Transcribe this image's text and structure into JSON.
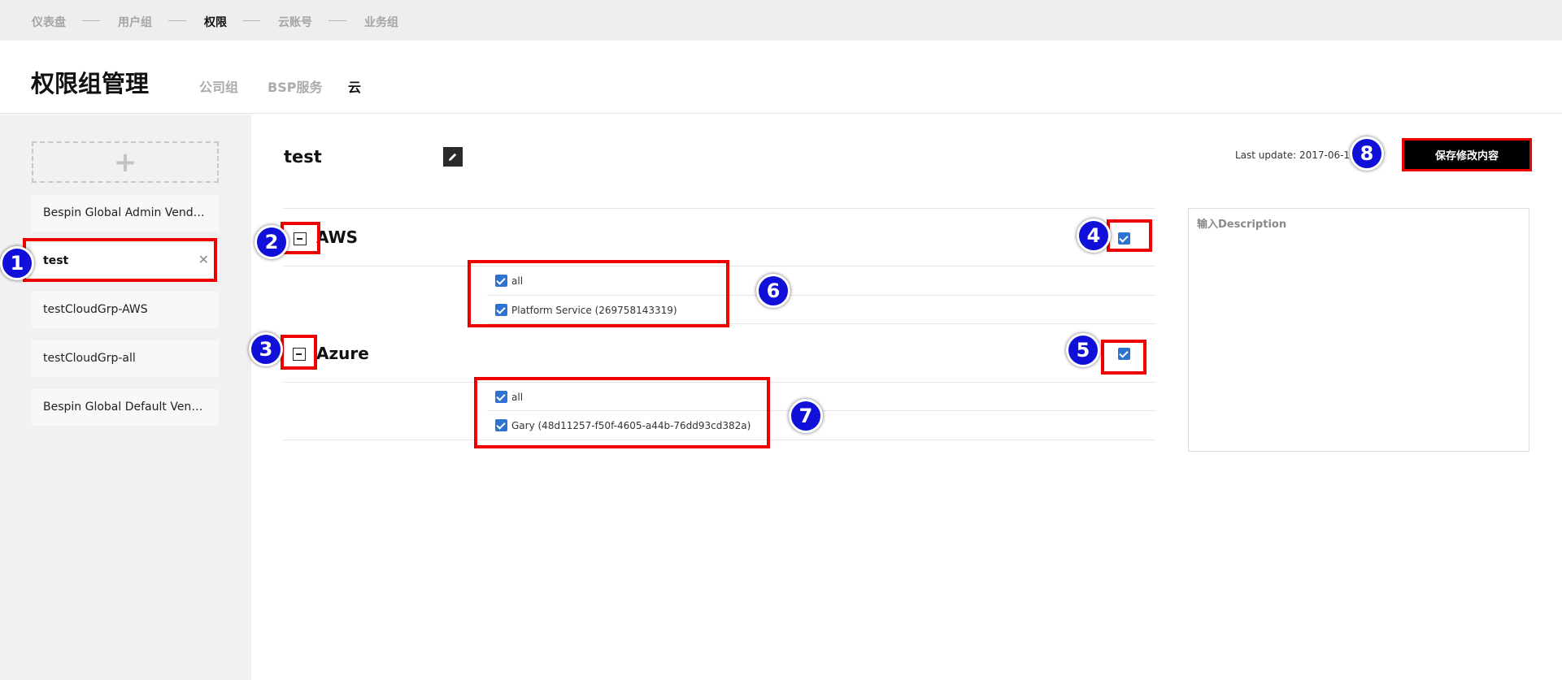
{
  "topnav": {
    "items": [
      {
        "label": "仪表盘",
        "active": false
      },
      {
        "label": "用户组",
        "active": false
      },
      {
        "label": "权限",
        "active": true
      },
      {
        "label": "云账号",
        "active": false
      },
      {
        "label": "业务组",
        "active": false
      }
    ]
  },
  "header": {
    "title": "权限组管理",
    "tabs": [
      {
        "label": "公司组",
        "active": false
      },
      {
        "label": "BSP服务",
        "active": false
      },
      {
        "label": "云",
        "active": true
      }
    ]
  },
  "sidebar": {
    "add_symbol": "+",
    "items": [
      {
        "label": "Bespin Global Admin Vendor···",
        "selected": false
      },
      {
        "label": "test",
        "selected": true
      },
      {
        "label": "testCloudGrp-AWS",
        "selected": false
      },
      {
        "label": "testCloudGrp-all",
        "selected": false
      },
      {
        "label": "Bespin Global Default Vendo···",
        "selected": false
      }
    ],
    "close_symbol": "✕"
  },
  "main": {
    "title": "test",
    "last_update": "Last update: 2017-06-12",
    "save_label": "保存修改内容",
    "sections": [
      {
        "name": "AWS",
        "checked": true,
        "items": [
          {
            "label": "all",
            "checked": true
          },
          {
            "label": "Platform Service (269758143319)",
            "checked": true
          }
        ]
      },
      {
        "name": "Azure",
        "checked": true,
        "items": [
          {
            "label": "all",
            "checked": true
          },
          {
            "label": "Gary (48d11257-f50f-4605-a44b-76dd93cd382a)",
            "checked": true
          }
        ]
      }
    ],
    "description_placeholder": "输入Description"
  },
  "annotations": [
    "1",
    "2",
    "3",
    "4",
    "5",
    "6",
    "7",
    "8"
  ],
  "colors": {
    "accent_checkbox": "#2e72d2",
    "annotation_red": "#ee0000",
    "annotation_badge": "#1010d8",
    "save_button": "#000000"
  }
}
